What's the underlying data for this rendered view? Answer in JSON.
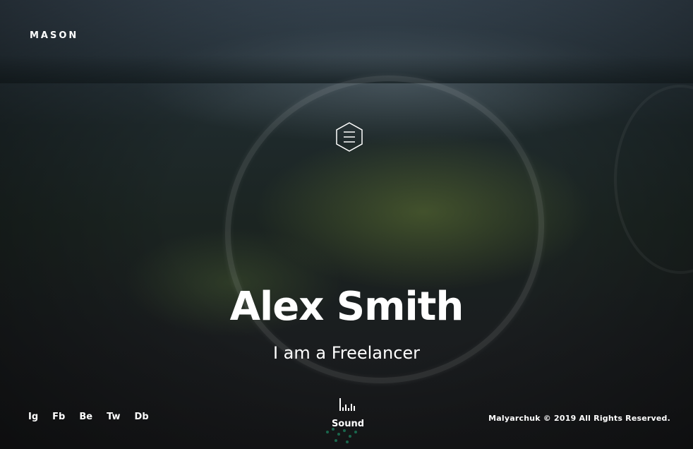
{
  "brand": {
    "logo_text": "MASON"
  },
  "menu": {
    "icon": "hamburger-hexagon-icon"
  },
  "hero": {
    "name": "Alex Smith",
    "subtitle": "I am a Freelancer"
  },
  "social": {
    "links": [
      "Ig",
      "Fb",
      "Be",
      "Tw",
      "Db"
    ]
  },
  "sound": {
    "label": "Sound",
    "icon": "equalizer-icon"
  },
  "footer": {
    "copyright": "Malyarchuk © 2019 All Rights Reserved."
  },
  "colors": {
    "text": "#ffffff",
    "accent_green": "#1c7a5a"
  }
}
